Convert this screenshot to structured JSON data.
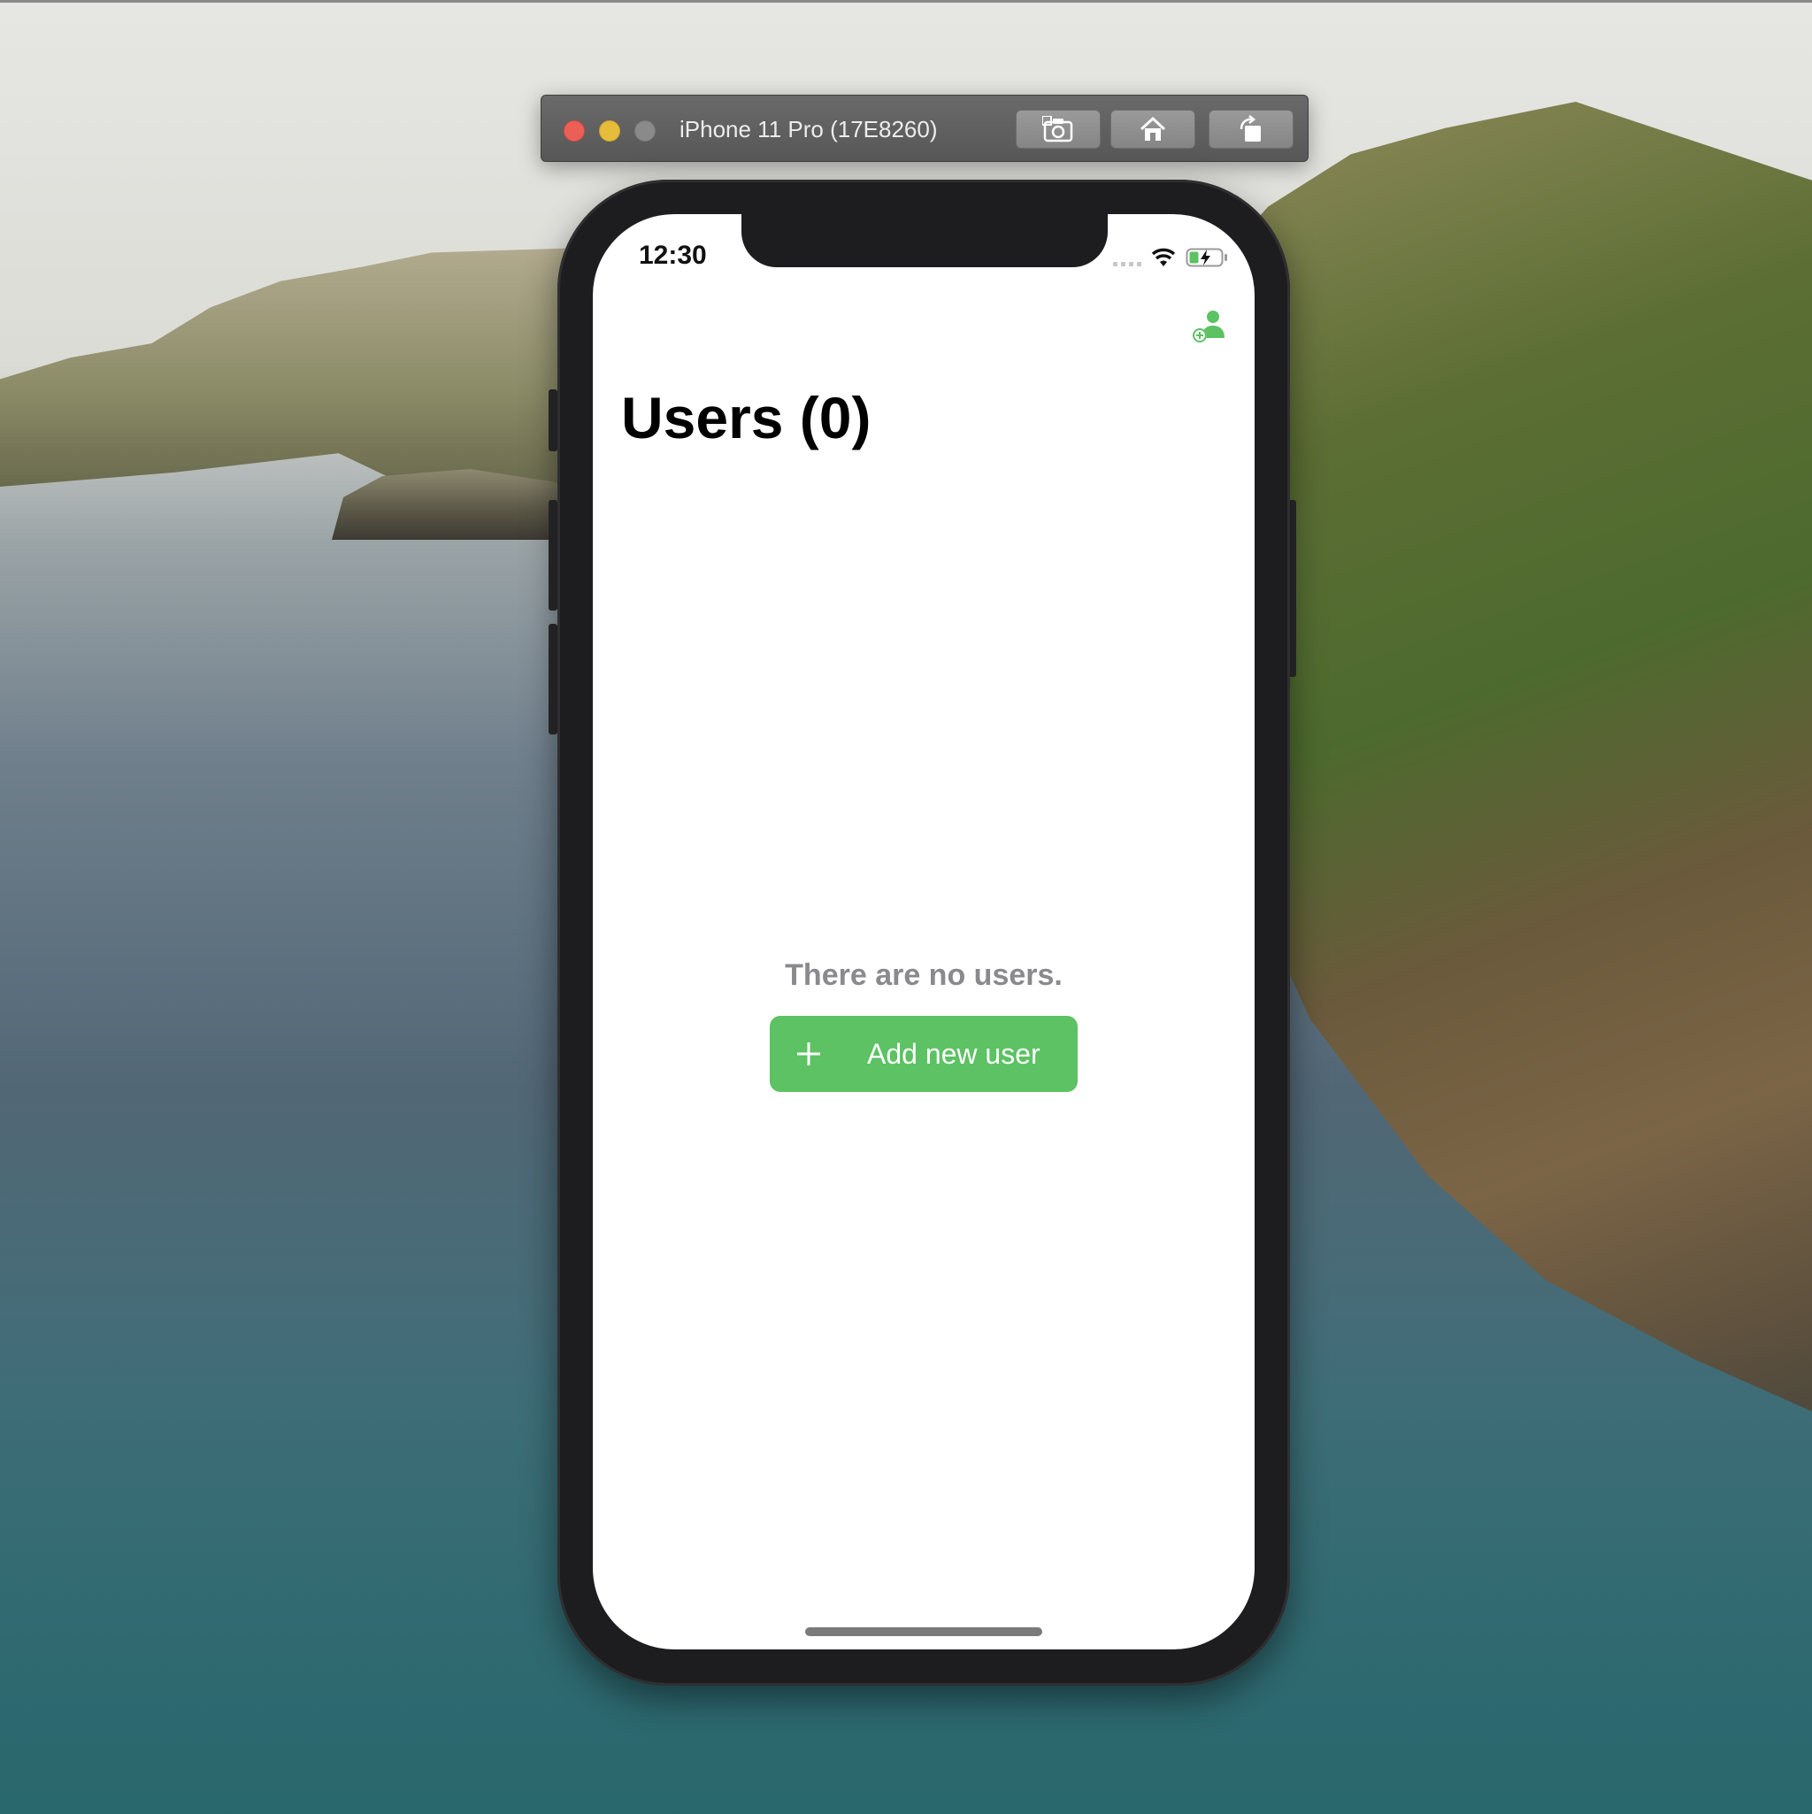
{
  "simulator": {
    "title": "iPhone 11 Pro (17E8260)",
    "toolbar_icons": [
      "screenshot-icon",
      "home-icon",
      "rotate-icon"
    ]
  },
  "status_bar": {
    "time": "12:30"
  },
  "nav": {
    "title": "Users (0)",
    "add_icon": "person-add-icon"
  },
  "content": {
    "empty_message": "There are no users.",
    "add_button_label": "Add new user"
  },
  "colors": {
    "accent": "#5cc263",
    "empty_text": "#8a8a8e"
  }
}
